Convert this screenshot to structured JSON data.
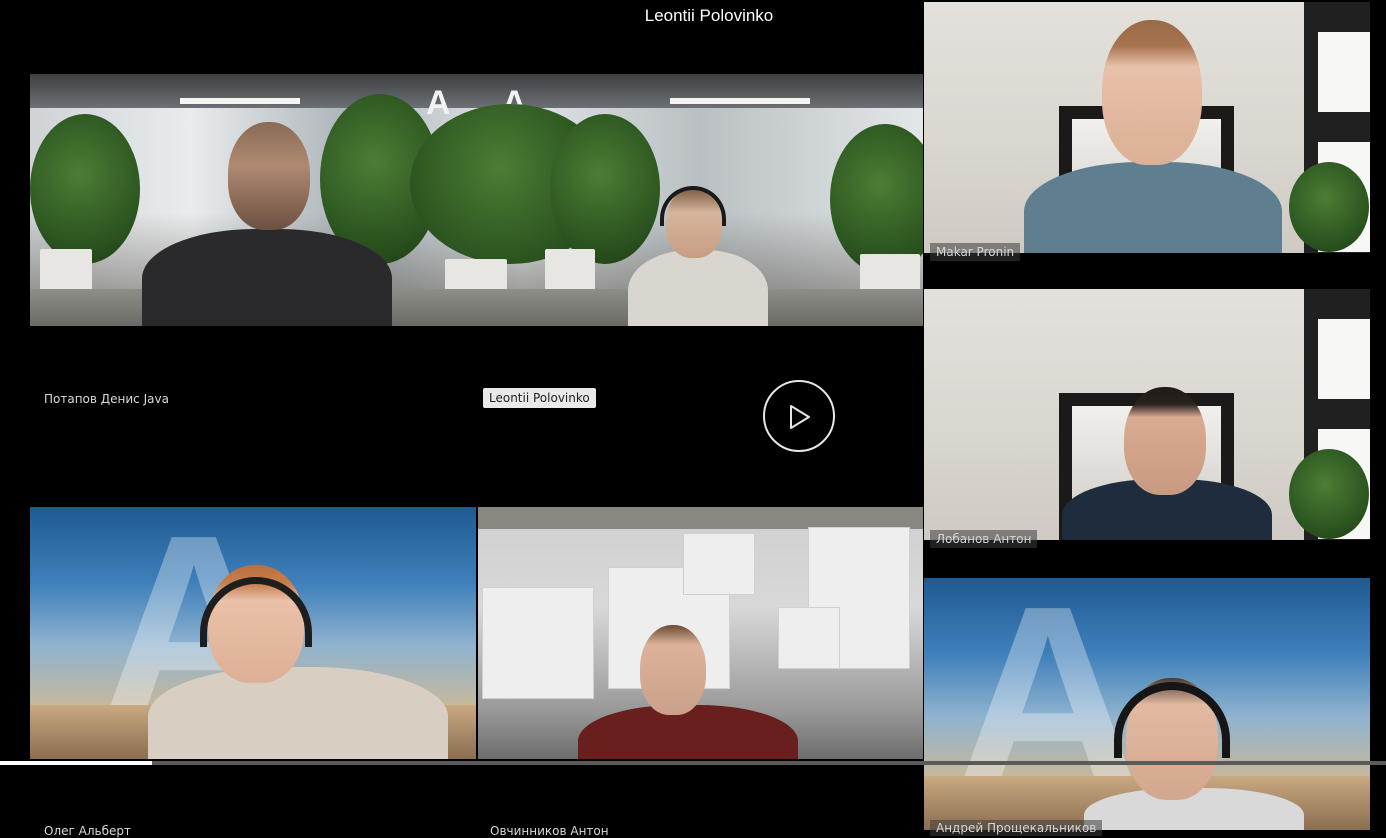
{
  "header": {
    "speaker_name": "Leontii Polovinko"
  },
  "participants": {
    "potapov": "Потапов Денис Java",
    "leontii": "Leontii Polovinko",
    "makar": "Makar Pronin",
    "lobanov": "Лобанов Антон",
    "oleg": "Олег Альберт",
    "ovchinnikov": "Овчинников Антон",
    "andrey": "Андрей Прощекальников"
  },
  "logo_letter": "A",
  "player": {
    "state": "paused",
    "progress_fraction": 0.11
  },
  "colors": {
    "background": "#000000",
    "progress_fill": "#ffffff",
    "progress_track": "#5a5a5a"
  }
}
